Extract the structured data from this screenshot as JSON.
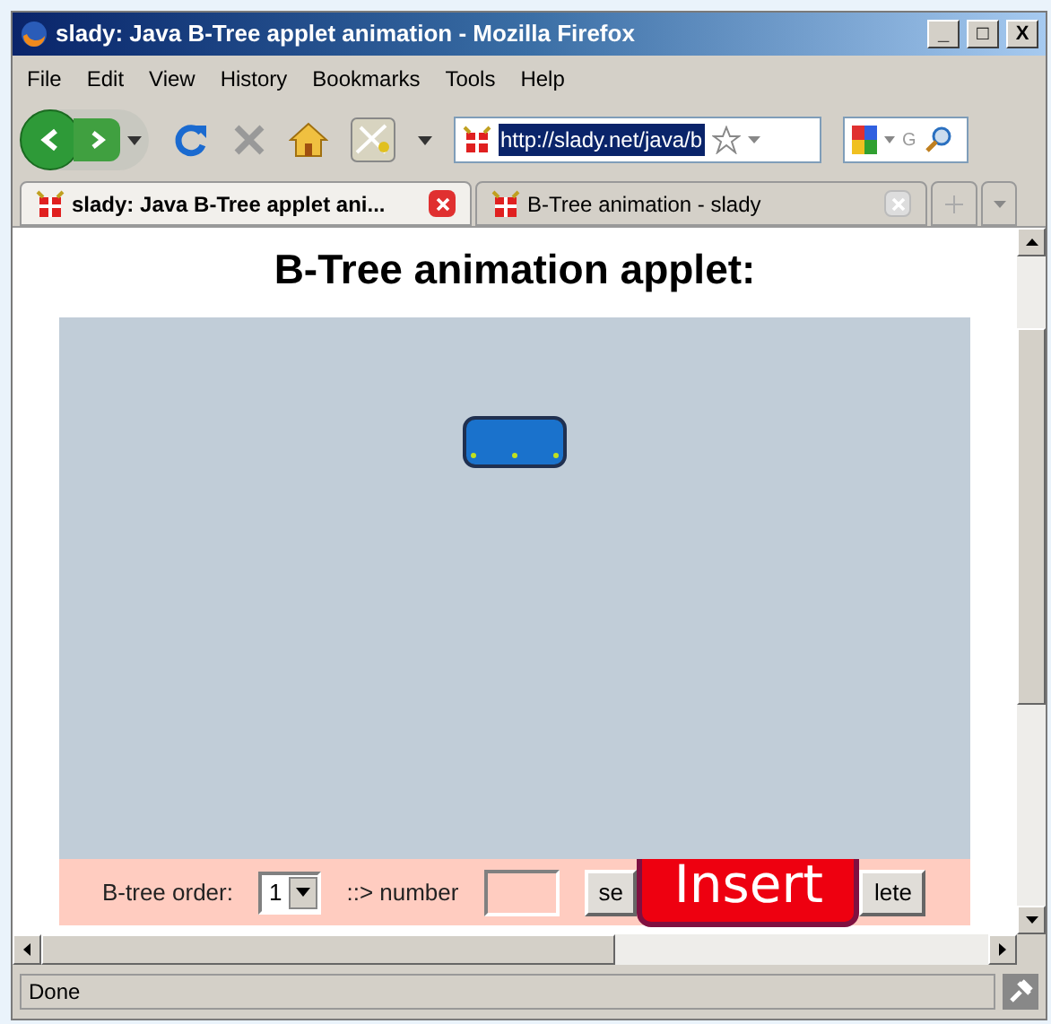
{
  "window": {
    "title": "slady: Java B-Tree applet animation - Mozilla Firefox",
    "controls": [
      "_",
      "□",
      "X"
    ]
  },
  "menu": [
    "File",
    "Edit",
    "View",
    "History",
    "Bookmarks",
    "Tools",
    "Help"
  ],
  "address": {
    "value": "http://slady.net/java/b",
    "selected": true
  },
  "search": {
    "placeholder": "G"
  },
  "tabs": [
    {
      "label": "slady: Java B-Tree applet ani...",
      "selected": true
    },
    {
      "label": "B-Tree animation - slady",
      "selected": false
    }
  ],
  "page": {
    "heading": "B-Tree animation applet:",
    "controls": [
      {
        "kind": "label",
        "text": "B-tree order:"
      },
      {
        "kind": "select",
        "value": "1"
      },
      {
        "kind": "label",
        "text": "::> number"
      },
      {
        "kind": "input"
      },
      {
        "kind": "button",
        "text": "se"
      },
      {
        "kind": "button",
        "text": "lete"
      }
    ],
    "overlay": "Insert"
  },
  "status_bar": "Done"
}
